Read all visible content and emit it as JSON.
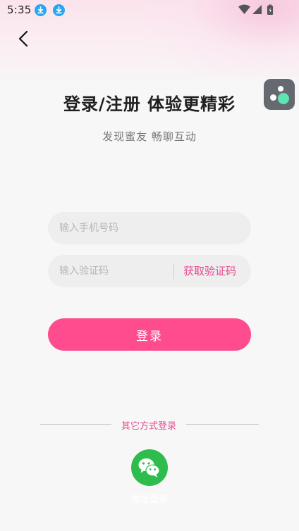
{
  "status_bar": {
    "time": "5:35",
    "icons": [
      "download-icon",
      "download-icon",
      "wifi-icon",
      "signal-icon",
      "battery-charging-icon"
    ]
  },
  "header": {
    "back_icon": "chevron-left-icon"
  },
  "floating_widget": {
    "icon": "widget-dots-icon"
  },
  "main": {
    "title": "登录/注册 体验更精彩",
    "subtitle": "发现蜜友 畅聊互动",
    "phone_input": {
      "value": "",
      "placeholder": "输入手机号码"
    },
    "code_input": {
      "value": "",
      "placeholder": "输入验证码"
    },
    "get_code_label": "获取验证码",
    "login_label": "登录"
  },
  "other_login": {
    "label": "其它方式登录",
    "wechat_icon": "wechat-icon",
    "wechat_label": "微信登录"
  },
  "colors": {
    "accent": "#fe4c8f",
    "accent_text": "#e84a8f",
    "wechat": "#2ebd4d",
    "download_badge": "#29a6f0",
    "widget_bg": "#646a70",
    "widget_dot": "#5fe3b0"
  }
}
